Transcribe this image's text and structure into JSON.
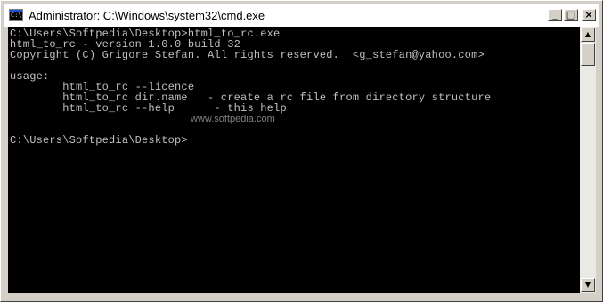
{
  "window": {
    "title": "Administrator: C:\\Windows\\system32\\cmd.exe",
    "icon": "cmd-icon",
    "controls": {
      "minimize": "_",
      "maximize": "□",
      "close": "×"
    }
  },
  "console": {
    "lines": [
      "C:\\Users\\Softpedia\\Desktop>html_to_rc.exe",
      "html_to_rc - version 1.0.0 build 32",
      "Copyright (C) Grigore Stefan. All rights reserved.  <g_stefan@yahoo.com>",
      "",
      "usage:",
      "        html_to_rc --licence",
      "        html_to_rc dir.name   - create a rc file from directory structure",
      "        html_to_rc --help      - this help",
      "",
      "",
      "C:\\Users\\Softpedia\\Desktop>"
    ],
    "watermark": "www.softpedia.com",
    "text_color": "#c0c0c0",
    "background": "#000000"
  },
  "scrollbar": {
    "up": "▲",
    "down": "▼"
  }
}
